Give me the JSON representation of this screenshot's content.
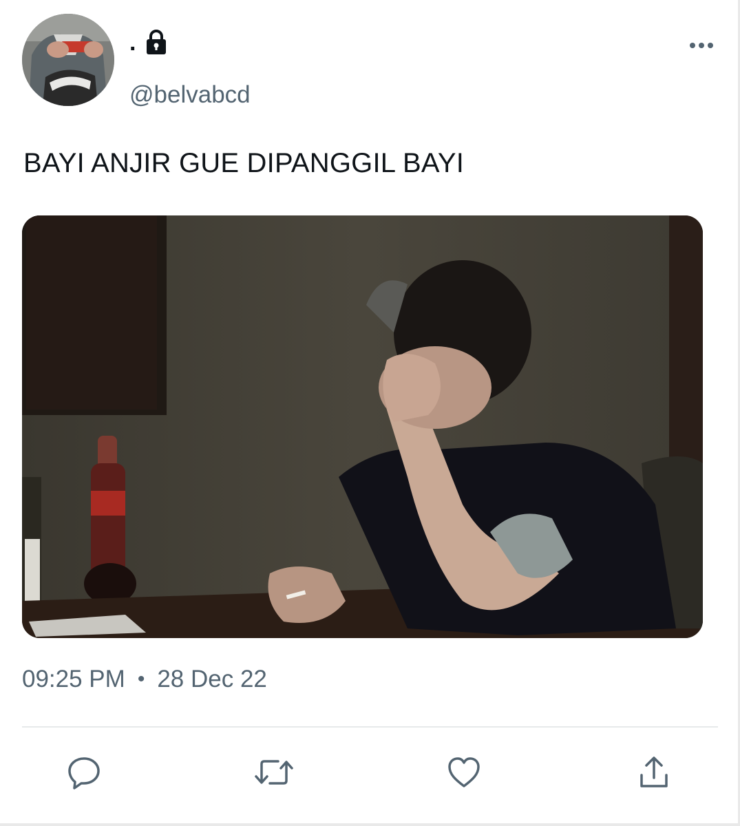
{
  "tweet": {
    "display_name": ".",
    "handle": "@belvabcd",
    "text": "BAYI ANJIR GUE DIPANGGIL BAYI",
    "time": "09:25 PM",
    "separator": "•",
    "date": "28 Dec 22",
    "account_protected": true
  },
  "icons": {
    "lock": "lock-icon",
    "more": "more-horizontal-icon",
    "reply": "reply-bubble-icon",
    "retweet": "retweet-icon",
    "like": "heart-icon",
    "share": "share-upload-icon"
  },
  "colors": {
    "text_primary": "#0f1419",
    "text_secondary": "#536471",
    "divider": "#e7e9ea"
  }
}
